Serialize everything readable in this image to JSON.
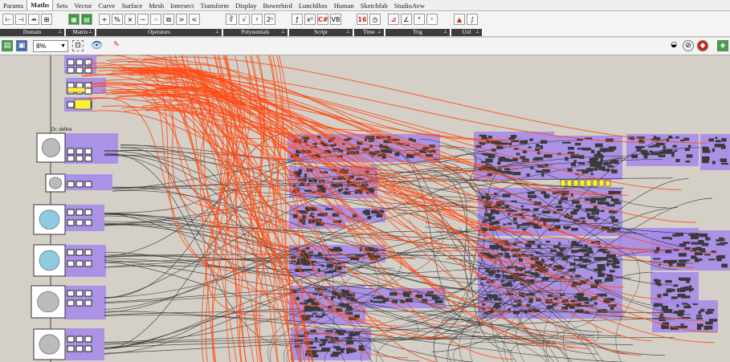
{
  "tabs": [
    {
      "label": "Params",
      "active": false
    },
    {
      "label": "Maths",
      "active": true
    },
    {
      "label": "Sets",
      "active": false
    },
    {
      "label": "Vector",
      "active": false
    },
    {
      "label": "Curve",
      "active": false
    },
    {
      "label": "Surface",
      "active": false
    },
    {
      "label": "Mesh",
      "active": false
    },
    {
      "label": "Intersect",
      "active": false
    },
    {
      "label": "Transform",
      "active": false
    },
    {
      "label": "Display",
      "active": false
    },
    {
      "label": "Bowerbird",
      "active": false
    },
    {
      "label": "LunchBox",
      "active": false
    },
    {
      "label": "Human",
      "active": false
    },
    {
      "label": "Sketchfab",
      "active": false
    },
    {
      "label": "StudioAvw",
      "active": false
    }
  ],
  "ribbon_groups": [
    {
      "label": "Domain",
      "icons": [
        "domain-icon",
        "divide-domain-icon",
        "bounds-icon",
        "construct-domain-icon"
      ],
      "glyphs": [
        "⊢",
        "⊣",
        "⇸",
        "⊞"
      ]
    },
    {
      "label": "Matrix",
      "icons": [
        "matrix-icon",
        "deconstruct-matrix-icon"
      ],
      "glyphs": [
        "▦",
        "▤"
      ]
    },
    {
      "label": "Operators",
      "icons": [
        "addition-icon",
        "division-icon",
        "multiplication-icon",
        "subtraction-icon",
        "gate-icon",
        "expression-icon",
        "larger-than-icon",
        "smaller-than-icon"
      ],
      "glyphs": [
        "+",
        "%",
        "×",
        "−",
        "⁘",
        "⧉",
        ">",
        "<"
      ]
    },
    {
      "label": "Polynomials",
      "icons": [
        "cube-root-icon",
        "square-root-icon",
        "log-icon",
        "power-of-2-icon"
      ],
      "glyphs": [
        "∛",
        "√",
        "ʸ",
        "2ⁿ"
      ]
    },
    {
      "label": "Script",
      "icons": [
        "function-icon",
        "variable-function-icon",
        "csharp-script-icon",
        "vb-script-icon"
      ],
      "glyphs": [
        "ƒ",
        "x²",
        "C#",
        "VB"
      ]
    },
    {
      "label": "Time",
      "icons": [
        "calendar-icon",
        "clock-icon"
      ],
      "glyphs": [
        "16",
        "◷"
      ]
    },
    {
      "label": "Trig",
      "icons": [
        "cosine-icon",
        "tangent-icon",
        "degrees-icon",
        "radians-icon"
      ],
      "glyphs": [
        "⊿",
        "∠",
        "°",
        "ᶜ"
      ]
    },
    {
      "label": "Util",
      "icons": [
        "smooth-numbers-icon",
        "gradient-icon"
      ],
      "glyphs": [
        "▲",
        "∫"
      ]
    }
  ],
  "toolbar": {
    "zoom_value": "8%",
    "left_icons": [
      "open-file-icon",
      "save-file-icon"
    ],
    "right_icons": [
      "rhino-preview-icon",
      "wire-display-icon",
      "selected-only-icon",
      "canvas-grid-icon"
    ]
  },
  "canvas": {
    "group_label": "Dr. define",
    "thumbnail_icons": [
      "skull-thumbnail-icon",
      "jaw-thumbnail-icon",
      "maxilla-blue-thumbnail-icon",
      "mandible-blue-thumbnail-icon",
      "skull-side-thumbnail-icon",
      "teeth-thumbnail-icon"
    ],
    "colors": {
      "canvas_bg": "#d4d0c8",
      "group_fill": "#a487ea",
      "component_fill": "#3a3a3a",
      "wire_selected": "#ff4a12",
      "wire_default": "#2a2a2a",
      "slider_fill": "#ffef3c"
    }
  }
}
